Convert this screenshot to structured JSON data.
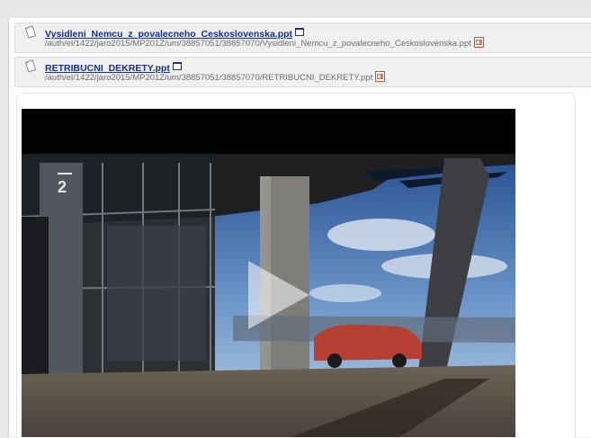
{
  "files": [
    {
      "name": "Vysidleni_Nemcu_z_povalecneho_Ceskoslovenska.ppt",
      "path": "/auth/el/1422/jaro2015/MP201Z/um/38857051/38857070/Vysidleni_Nemcu_z_povalecneho_Ceskoslovenska.ppt"
    },
    {
      "name": "RETRIBUCNI_DEKRETY.ppt",
      "path": "/auth/el/1422/jaro2015/MP201Z/um/38857051/38857070/RETRIBUCNI_DEKRETY.ppt"
    }
  ],
  "video": {
    "channel_badge": "2"
  },
  "colors": {
    "link": "#1a2e8c",
    "path_text": "#6e6e6e",
    "row_bg": "#f0f0f0"
  },
  "icons": [
    "document-icon",
    "new-window-icon",
    "ppt-file-icon",
    "play-icon"
  ]
}
